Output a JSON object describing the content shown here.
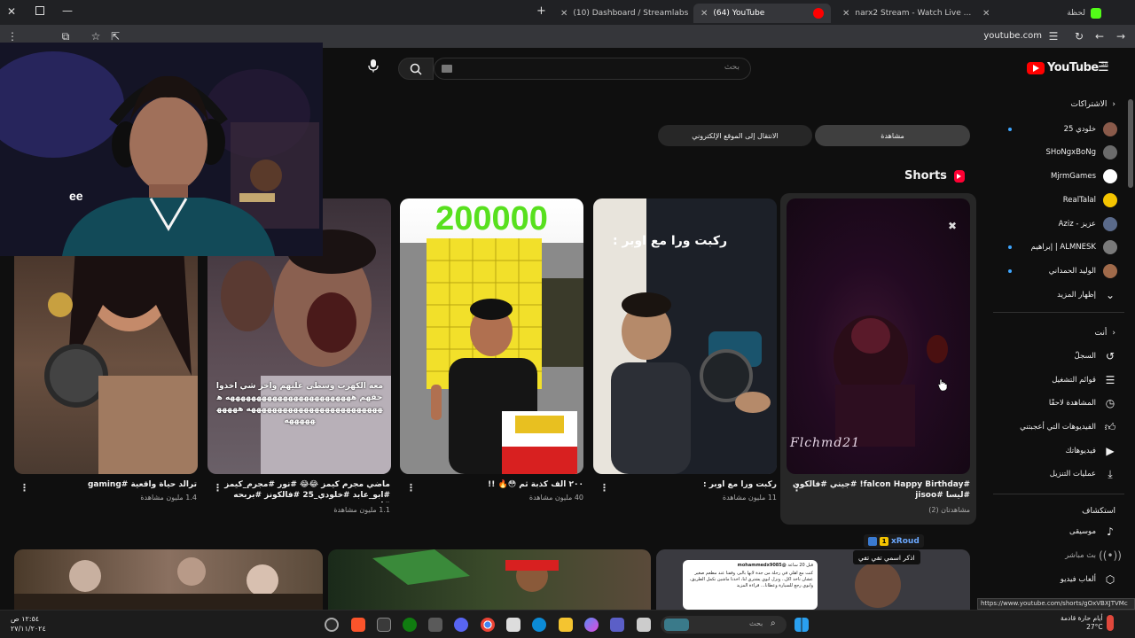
{
  "browser": {
    "tabs": [
      {
        "label": "(10) Dashboard / Streamlabs",
        "color": "#31c48d"
      },
      {
        "label": "(64) YouTube",
        "color": "#ff0000"
      },
      {
        "label": "narx2 Stream - Watch Live ...",
        "color": "#53fc18"
      },
      {
        "label": "لحظة",
        "color": "#53fc18"
      }
    ],
    "url": "youtube.com"
  },
  "youtube": {
    "logo_text": "YouTube",
    "region": "SA",
    "search_placeholder": "بحث",
    "chips": {
      "watch": "مشاهدة",
      "goto_site": "الانتقال إلى الموقع الإلكتروني"
    },
    "shorts_heading": "Shorts",
    "sidebar": {
      "subscriptions_title": "الاشتراكات",
      "channels": [
        {
          "name": "خلودي 25",
          "avatar_color": "#8a5a4a",
          "live": true
        },
        {
          "name": "SHoNgxBoNg",
          "avatar_color": "#6b6b6b",
          "live": false
        },
        {
          "name": "MjrmGames",
          "avatar_color": "#ffffff",
          "live": false
        },
        {
          "name": "RealTalal",
          "avatar_color": "#f4c400",
          "live": false
        },
        {
          "name": "Aziz - عزيز",
          "avatar_color": "#5a6a8a",
          "live": false
        },
        {
          "name": "إبراهيم | ALMNESK",
          "avatar_color": "#7a7a7a",
          "live": true
        },
        {
          "name": "الوليد الحمداني",
          "avatar_color": "#a06a4a",
          "live": true
        }
      ],
      "show_more": "إظهار المزيد",
      "you_title": "أنت",
      "you_items": [
        {
          "label": "السجلّ",
          "icon": "history-icon"
        },
        {
          "label": "قوائم التشغيل",
          "icon": "playlist-icon"
        },
        {
          "label": "المشاهدة لاحقًا",
          "icon": "clock-icon"
        },
        {
          "label": "الفيديوهات التي أعجبتني",
          "icon": "thumbs-up-icon"
        },
        {
          "label": "فيديوهاتك",
          "icon": "video-icon"
        },
        {
          "label": "عمليات التنزيل",
          "icon": "download-icon"
        }
      ],
      "explore_title": "استكشاف",
      "explore_items": [
        {
          "label": "موسيقى",
          "icon": "music-icon"
        },
        {
          "label": "بث مباشر",
          "icon": "live-icon"
        },
        {
          "label": "ألعاب فيديو",
          "icon": "gaming-icon"
        }
      ]
    },
    "shorts": [
      {
        "title": "#falcon Happy Birthday! #جيني #فالكون #ليسا #jisoo",
        "views": "مشاهدتان (2)",
        "overlay": "Flchmd21"
      },
      {
        "title": "ركبت ورا مع اوبر :",
        "views": "11 مليون مشاهدة",
        "overlay": "ركبت ورا مع اوبر :"
      },
      {
        "title": "٢٠٠ الف كذبة ثم 😳🔥 !!",
        "views": "40 مليون مشاهدة",
        "overlay": "200000"
      },
      {
        "title": "ماضي مجرم كيمز 😂😂 #نور #مجرم_كيمز #ابو_عابد #خلودي_25 #فالكونز #بربحه #ابو_ش...",
        "views": "1.1 مليون مشاهدة",
        "overlay": "معه الكهرب وسطى عليهم واخر شي اخذوا حقهم ههههههههههههههههههههههههه ههههههههههههههههههههههههههه ههههههههههه"
      },
      {
        "title": "ترالد حياة واقعية #gaming",
        "views": "1.4 مليون مشاهدة",
        "overlay": ""
      }
    ],
    "notification_card": {
      "handle": "@mohammedx9085",
      "text": "كنت مع اهلي في رحلة من جدة لابها بالبر، وقفنا عند مطعم صغير عشان ناخذ اكل.. ونزل ابوي يشتري لنا، اخذنا ماشين نكمل الطريق، وابوي رجع للسيارة وعطانا... قراءة المزيد",
      "time": "قبل 20 ساعة"
    },
    "status_url": "https://www.youtube.com/shorts/gOxVBXJTVMc"
  },
  "stream_overlay": {
    "badge_name": "xRoud",
    "badge_level": "1",
    "message": "اذكر اسمي تفي تفي"
  },
  "taskbar": {
    "time": "١٢:٥٤ ص",
    "date": "٢٧/١١/٢٠٢٤",
    "search_placeholder": "بحث",
    "weather_label": "أيام حارة قادمة",
    "weather_temp": "27°C"
  }
}
